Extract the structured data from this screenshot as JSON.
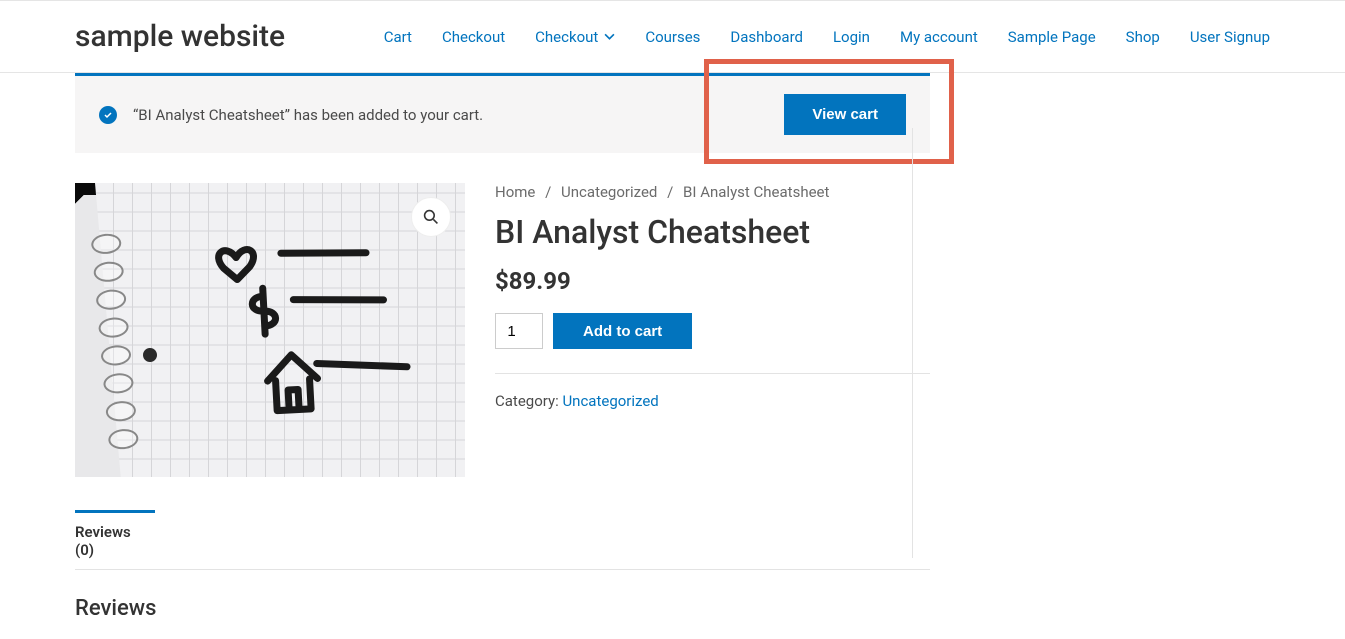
{
  "site_title": "sample website",
  "nav": [
    {
      "label": "Cart"
    },
    {
      "label": "Checkout"
    },
    {
      "label": "Checkout",
      "dropdown": true
    },
    {
      "label": "Courses"
    },
    {
      "label": "Dashboard"
    },
    {
      "label": "Login"
    },
    {
      "label": "My account"
    },
    {
      "label": "Sample Page"
    },
    {
      "label": "Shop"
    },
    {
      "label": "User Signup"
    }
  ],
  "notice": {
    "text": "“BI Analyst Cheatsheet” has been added to your cart.",
    "button": "View cart"
  },
  "breadcrumb": {
    "home": "Home",
    "cat": "Uncategorized",
    "current": "BI Analyst Cheatsheet"
  },
  "product": {
    "title": "BI Analyst Cheatsheet",
    "price": "$89.99",
    "qty": "1",
    "add_label": "Add to cart",
    "category_label": "Category: ",
    "category_link": "Uncategorized"
  },
  "tabs": {
    "reviews": "Reviews (0)"
  },
  "reviews_heading": "Reviews"
}
